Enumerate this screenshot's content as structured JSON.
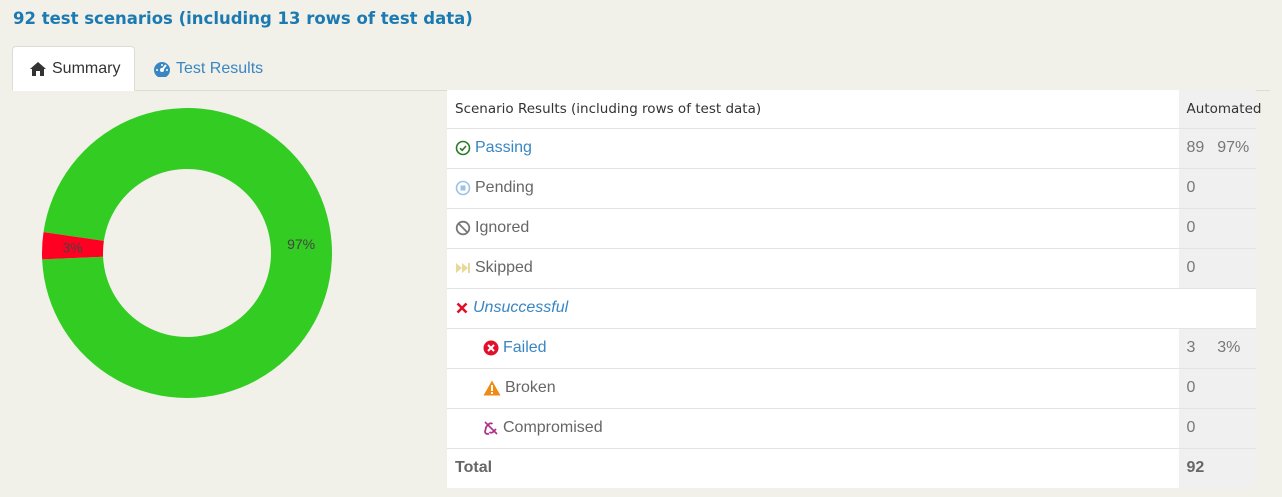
{
  "page": {
    "title": "92 test scenarios (including 13 rows of test data)"
  },
  "tabs": [
    {
      "label": "Summary",
      "icon": "home-icon",
      "active": true
    },
    {
      "label": "Test Results",
      "icon": "dashboard-icon",
      "active": false
    }
  ],
  "donut": {
    "passing_pct": 97,
    "failed_pct": 3,
    "passing_label": "97%",
    "failed_label": "3%",
    "colors": {
      "passing": "#33cc22",
      "failed": "#ff0022"
    }
  },
  "table": {
    "header": {
      "name": "Scenario Results (including rows of test data)",
      "automated": "Automated"
    },
    "rows": [
      {
        "name": "Passing",
        "icon": "check-circle-icon",
        "count": "89",
        "pct": "97%"
      },
      {
        "name": "Pending",
        "icon": "stop-circle-icon",
        "count": "0",
        "pct": ""
      },
      {
        "name": "Ignored",
        "icon": "ban-icon",
        "count": "0",
        "pct": ""
      },
      {
        "name": "Skipped",
        "icon": "fast-forward-icon",
        "count": "0",
        "pct": ""
      },
      {
        "name": "Unsuccessful",
        "icon": "x-icon"
      },
      {
        "name": "Failed",
        "icon": "times-circle-icon",
        "count": "3",
        "pct": "3%"
      },
      {
        "name": "Broken",
        "icon": "warning-icon",
        "count": "0",
        "pct": ""
      },
      {
        "name": "Compromised",
        "icon": "unlink-icon",
        "count": "0",
        "pct": ""
      }
    ],
    "total": {
      "label": "Total",
      "count": "92"
    }
  }
}
